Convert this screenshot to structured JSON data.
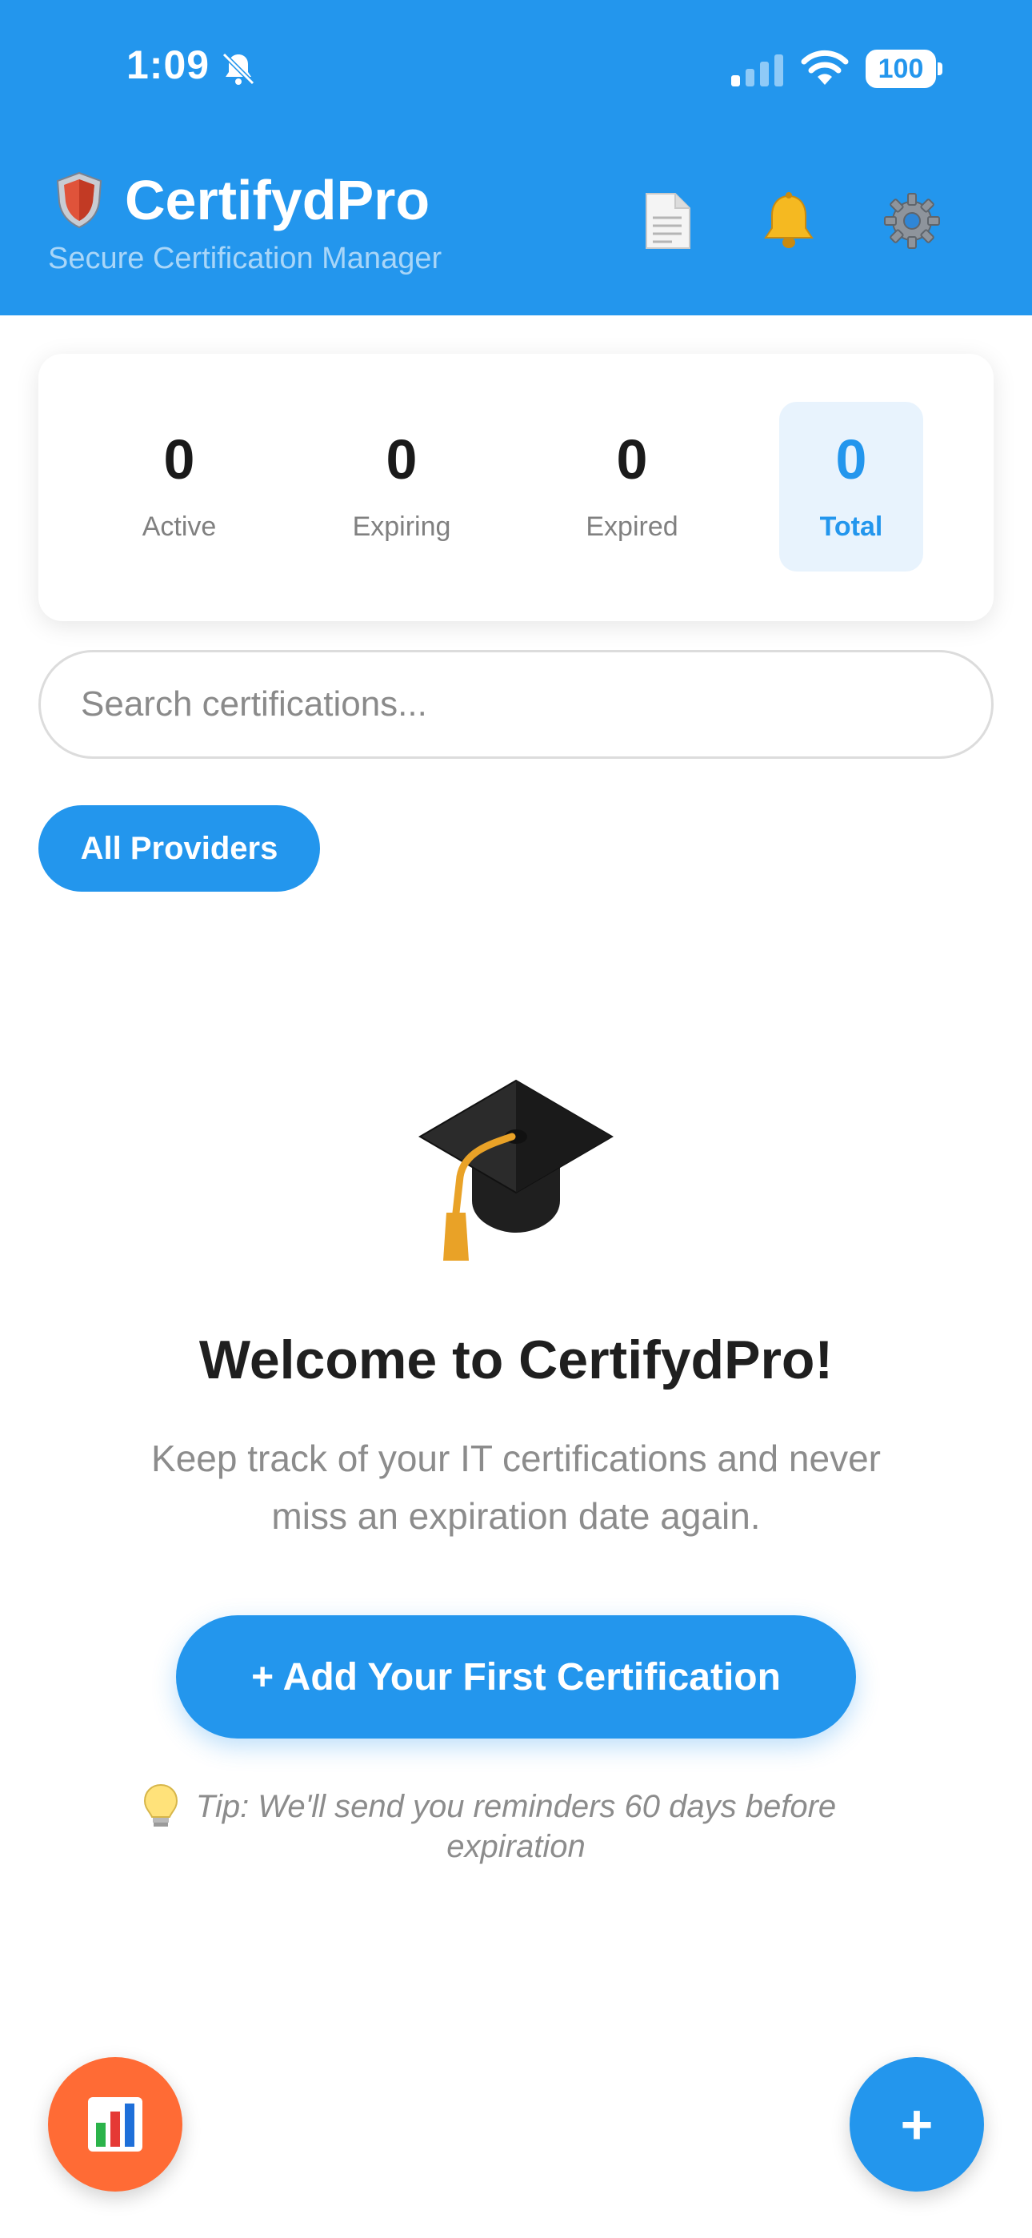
{
  "status_bar": {
    "time": "1:09",
    "battery": "100"
  },
  "header": {
    "title": "CertifydPro",
    "subtitle": "Secure Certification Manager",
    "brand_icon": "shield-icon",
    "actions": [
      {
        "icon": "document-icon"
      },
      {
        "icon": "bell-icon"
      },
      {
        "icon": "gear-icon"
      }
    ]
  },
  "stats": {
    "active": {
      "value": "0",
      "label": "Active"
    },
    "expiring": {
      "value": "0",
      "label": "Expiring"
    },
    "expired": {
      "value": "0",
      "label": "Expired"
    },
    "total": {
      "value": "0",
      "label": "Total"
    }
  },
  "search": {
    "placeholder": "Search certifications..."
  },
  "filters": {
    "selected": "All Providers"
  },
  "empty_state": {
    "icon": "graduation-cap-icon",
    "title": "Welcome to CertifydPro!",
    "description": "Keep track of your IT certifications and never miss an expiration date again.",
    "cta_label": "+ Add Your First Certification",
    "tip": "Tip: We'll send you reminders 60 days before expiration"
  },
  "fabs": {
    "add_label": "+"
  },
  "colors": {
    "primary": "#2396ed",
    "accent_orange": "#ff6b35"
  }
}
